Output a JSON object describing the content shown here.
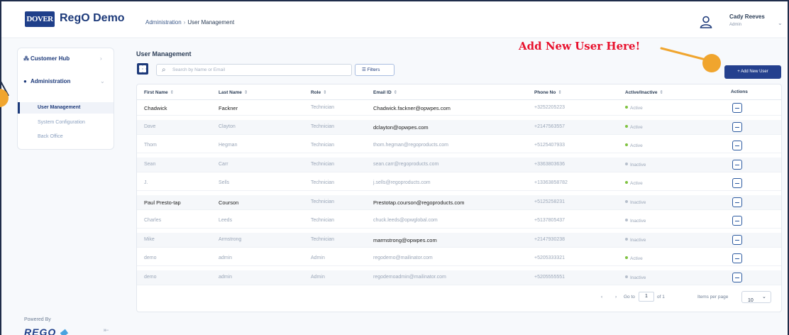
{
  "header": {
    "logo_text": "DOVER",
    "app_title": "RegO Demo",
    "breadcrumb": [
      "Administration",
      "User Management"
    ],
    "user_name": "Cady Reeves",
    "user_role": "Admin"
  },
  "sidebar": {
    "sections": [
      {
        "label": "Customer Hub",
        "icon": "people-icon"
      },
      {
        "label": "Administration",
        "icon": "person-icon"
      }
    ],
    "sub_items": [
      "User Management",
      "System Configuration",
      "Back Office"
    ],
    "powered_by": "Powered By",
    "brand": "REGO"
  },
  "main": {
    "title": "User Management",
    "search_placeholder": "Search by Name or Email",
    "filters_label": "Filters",
    "add_user_label": "+ Add New User",
    "columns": [
      "First Name",
      "Last Name",
      "Role",
      "Email ID",
      "Phone No",
      "Active/Inactive",
      "Actions"
    ],
    "rows": [
      {
        "first": "Chadwick",
        "last": "Fackner",
        "role": "Technician",
        "email": "Chadwick.fackner@opwpes.com",
        "phone": "+3252205223",
        "status": "Active"
      },
      {
        "first": "Dave",
        "last": "Clayton",
        "role": "Technician",
        "email": "dclayton@opwpes.com",
        "phone": "+2147563557",
        "status": "Active"
      },
      {
        "first": "Thom",
        "last": "Hegman",
        "role": "Technician",
        "email": "thom.hegman@regoproducts.com",
        "phone": "+5125407933",
        "status": "Active"
      },
      {
        "first": "Sean",
        "last": "Carr",
        "role": "Technician",
        "email": "sean.carr@regoproducts.com",
        "phone": "+3363803636",
        "status": "Inactive"
      },
      {
        "first": "J.",
        "last": "Sells",
        "role": "Technician",
        "email": "j.sells@regoproducts.com",
        "phone": "+13363858782",
        "status": "Active"
      },
      {
        "first": "Paul Presto-tap",
        "last": "Courson",
        "role": "Technician",
        "email": "Prestotap.courson@regoproducts.com",
        "phone": "+5125258231",
        "status": "Inactive"
      },
      {
        "first": "Charles",
        "last": "Leeds",
        "role": "Technician",
        "email": "chuck.leeds@opwglobal.com",
        "phone": "+5137805437",
        "status": "Inactive"
      },
      {
        "first": "Mike",
        "last": "Armstrong",
        "role": "Technician",
        "email": "marmstrong@opwpes.com",
        "phone": "+2147930238",
        "status": "Inactive"
      },
      {
        "first": "demo",
        "last": "admin",
        "role": "Admin",
        "email": "regodemo@mailinator.com",
        "phone": "+5205333321",
        "status": "Active"
      },
      {
        "first": "demo",
        "last": "admin",
        "role": "Admin",
        "email": "regodemoadmin@mailinator.com",
        "phone": "+5205555551",
        "status": "Inactive"
      }
    ],
    "pagination": {
      "prev": "‹",
      "next": "›",
      "go_to_label": "Go to",
      "page_value": "1",
      "of_total": "of 1",
      "items_per_page_label": "Items per page",
      "items_per_page_value": "10"
    }
  },
  "annotation": {
    "callout_text": "Add New User Here!"
  },
  "colors": {
    "brand": "#1d3a7a",
    "primary_button": "#24408e",
    "active_dot": "#7fc241",
    "inactive_dot": "#b6bfcc",
    "callout_red": "#e8112d",
    "marker_orange": "#f0a52e"
  }
}
